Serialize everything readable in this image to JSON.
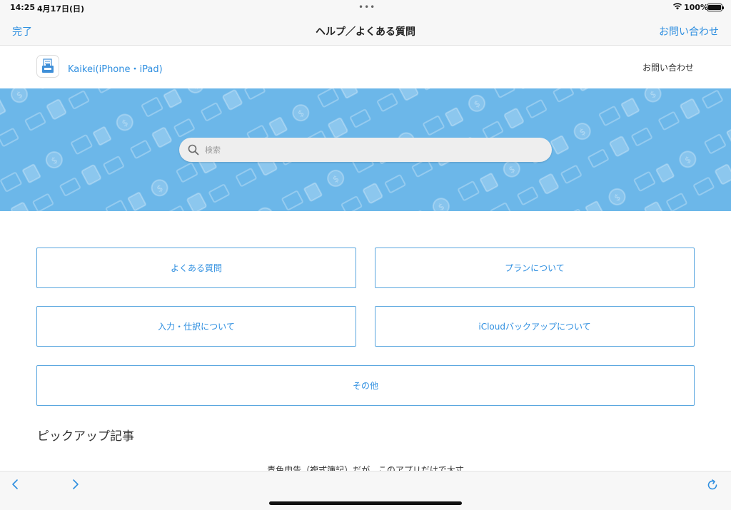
{
  "status_bar": {
    "time": "14:25",
    "date": "4月17日(日)",
    "battery": "100%"
  },
  "nav": {
    "done_label": "完了",
    "title": "ヘルプ／よくある質問",
    "contact_label": "お問い合わせ"
  },
  "app_header": {
    "app_name": "Kaikei(iPhone・iPad)",
    "contact_label": "お問い合わせ"
  },
  "hero": {
    "background_color": "#6cb7e9",
    "search_placeholder": "検索"
  },
  "categories": [
    {
      "label": "よくある質問"
    },
    {
      "label": "プランについて"
    },
    {
      "label": "入力・仕訳について"
    },
    {
      "label": "iCloudバックアップについて"
    },
    {
      "label": "その他"
    }
  ],
  "pickup": {
    "title": "ピックアップ記事",
    "first_article": "青色申告（複式簿記）だが、このアプリだけで大丈"
  },
  "colors": {
    "accent": "#2f8fe0",
    "border": "#5aa7df"
  }
}
